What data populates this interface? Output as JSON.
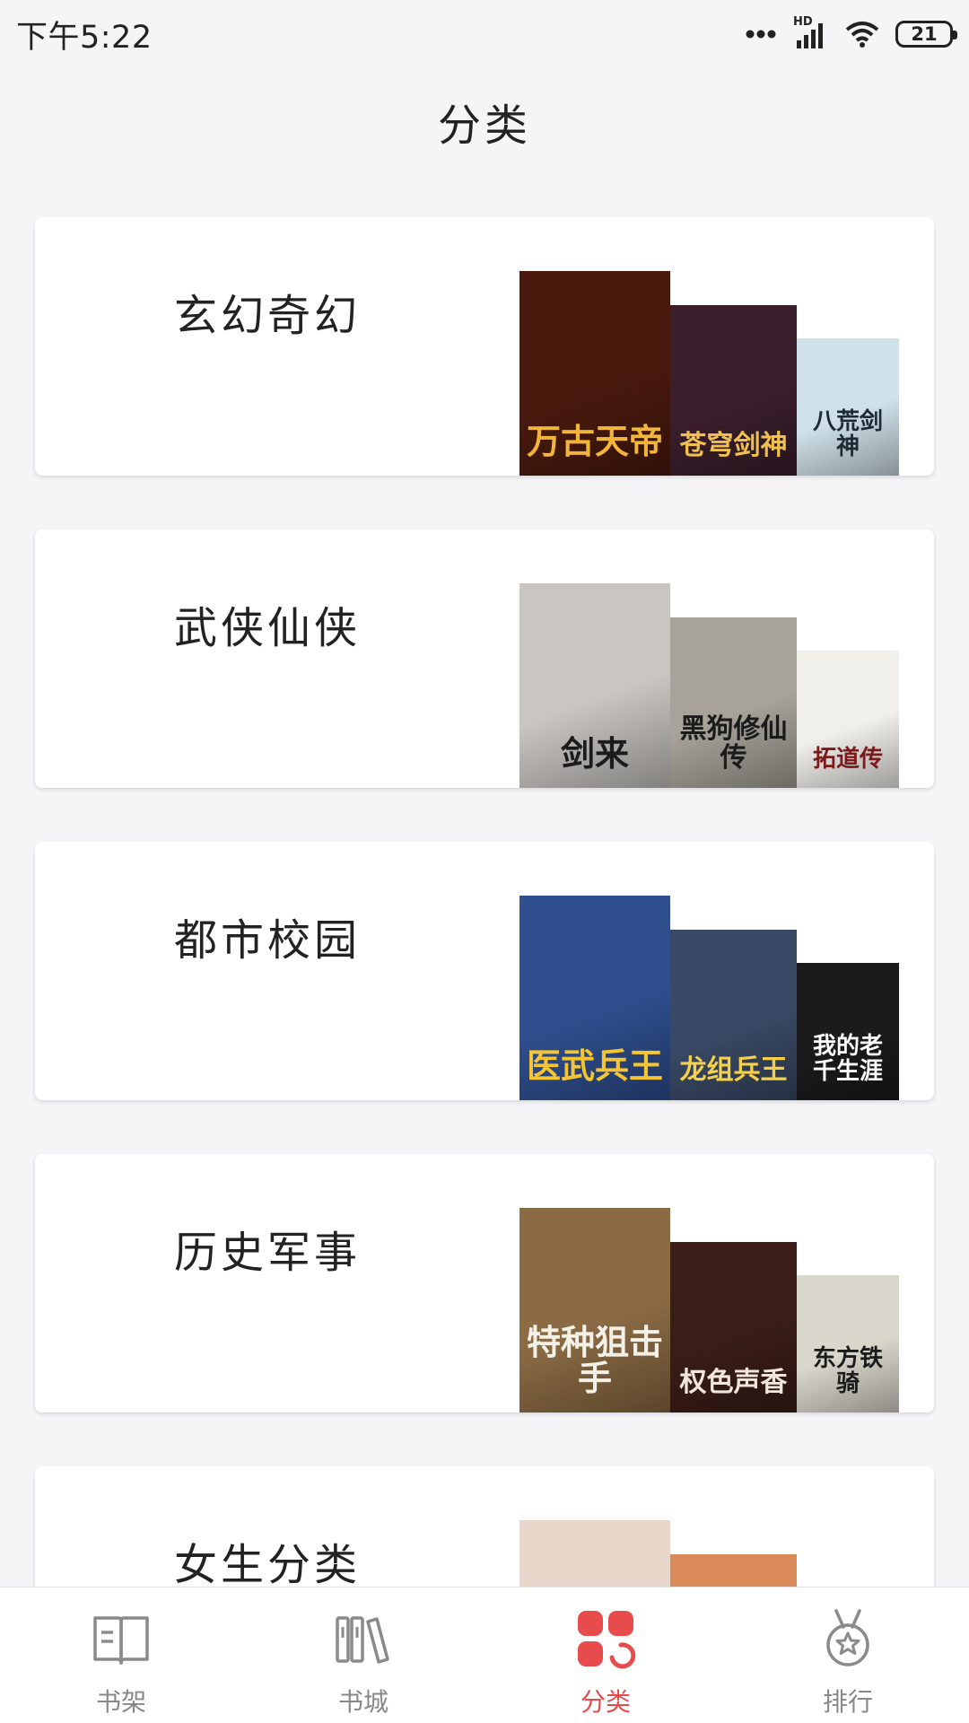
{
  "status_bar": {
    "time": "下午5:22",
    "network": "HD",
    "battery": "21"
  },
  "header": {
    "title": "分类"
  },
  "categories": [
    {
      "name": "玄幻奇幻",
      "covers": [
        {
          "title": "万古天帝",
          "bg": "#4a1a0e",
          "fg": "#f2b53a"
        },
        {
          "title": "苍穹剑神",
          "bg": "#3b1f2c",
          "fg": "#f0c050"
        },
        {
          "title": "八荒剑神",
          "bg": "#cfe0e8",
          "fg": "#1e2a33"
        }
      ]
    },
    {
      "name": "武侠仙侠",
      "covers": [
        {
          "title": "剑来",
          "bg": "#c9c6c2",
          "fg": "#1b1b1b"
        },
        {
          "title": "黑狗修仙传",
          "bg": "#a7a39b",
          "fg": "#1b1b1b"
        },
        {
          "title": "拓道传",
          "bg": "#f1efea",
          "fg": "#7a1a1a"
        }
      ]
    },
    {
      "name": "都市校园",
      "covers": [
        {
          "title": "医武兵王",
          "bg": "#2f4f8f",
          "fg": "#f5c431"
        },
        {
          "title": "龙组兵王",
          "bg": "#3a4a66",
          "fg": "#f5d04a"
        },
        {
          "title": "我的老千生涯",
          "bg": "#1b1b1b",
          "fg": "#ffffff"
        }
      ]
    },
    {
      "name": "历史军事",
      "covers": [
        {
          "title": "特种狙击手",
          "bg": "#8b6b44",
          "fg": "#f3f0e8"
        },
        {
          "title": "权色声香",
          "bg": "#3a1d17",
          "fg": "#f2e6da"
        },
        {
          "title": "东方铁骑",
          "bg": "#d9d6cc",
          "fg": "#1b1b1b"
        }
      ]
    },
    {
      "name": "女生分类",
      "covers": [
        {
          "title": "",
          "bg": "#e9d7cc",
          "fg": "#6a2a2a"
        },
        {
          "title": "",
          "bg": "#d98a58",
          "fg": "#ffffff"
        },
        {
          "title": "",
          "bg": "#f5f5f7",
          "fg": "#ffffff"
        }
      ]
    }
  ],
  "bottom_nav": {
    "items": [
      {
        "label": "书架",
        "icon": "book-open-icon",
        "active": false
      },
      {
        "label": "书城",
        "icon": "bookshelf-icon",
        "active": false
      },
      {
        "label": "分类",
        "icon": "category-grid-icon",
        "active": true
      },
      {
        "label": "排行",
        "icon": "medal-icon",
        "active": false
      }
    ],
    "active_color": "#e84b4b",
    "inactive_color": "#888888"
  }
}
